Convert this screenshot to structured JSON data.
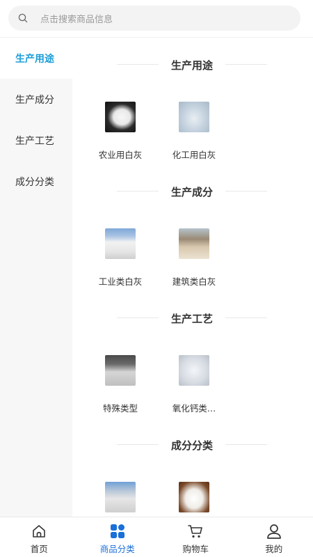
{
  "search": {
    "placeholder": "点击搜索商品信息"
  },
  "sidebar": {
    "items": [
      {
        "label": "生产用途",
        "active": true
      },
      {
        "label": "生产成分",
        "active": false
      },
      {
        "label": "生产工艺",
        "active": false
      },
      {
        "label": "成分分类",
        "active": false
      }
    ]
  },
  "sections": [
    {
      "title": "生产用途",
      "items": [
        {
          "name": "农业用白灰"
        },
        {
          "name": "化工用白灰"
        }
      ]
    },
    {
      "title": "生产成分",
      "items": [
        {
          "name": "工业类白灰"
        },
        {
          "name": "建筑类白灰"
        }
      ]
    },
    {
      "title": "生产工艺",
      "items": [
        {
          "name": "特殊类型"
        },
        {
          "name": "氧化钙类…"
        }
      ]
    },
    {
      "title": "成分分类",
      "items": [
        {
          "name": ""
        },
        {
          "name": ""
        }
      ]
    }
  ],
  "tabbar": {
    "tabs": [
      {
        "label": "首页",
        "icon": "home-icon",
        "active": false
      },
      {
        "label": "商品分类",
        "icon": "category-icon",
        "active": true
      },
      {
        "label": "购物车",
        "icon": "cart-icon",
        "active": false
      },
      {
        "label": "我的",
        "icon": "user-icon",
        "active": false
      }
    ]
  },
  "colors": {
    "accent": "#1a9ed8",
    "tab_active": "#1a6fd8",
    "sidebar_bg": "#f7f7f7"
  }
}
